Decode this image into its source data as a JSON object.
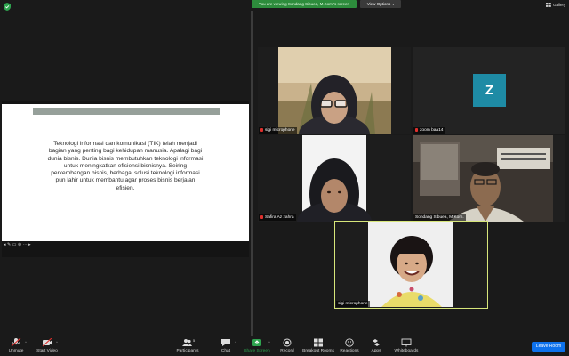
{
  "top_bar": {
    "banner": "You are viewing Sondang Sibuea, M.Kom.'s screen",
    "view_options": "View Options",
    "gallery_view": "Gallery"
  },
  "shared_screen": {
    "slide_text": "Teknologi informasi dan komunikasi (TIK) telah menjadi bagian yang penting bagi kehidupan manusia. Apalagi bagi dunia bisnis. Dunia bisnis membutuhkan teknologi informasi untuk meningkatkan efisiensi bisnisnya. Seiring perkembangan bisnis, berbagai solusi teknologi informasi pun lahir untuk membantu agar proses bisnis berjalan efisien."
  },
  "participants": [
    {
      "name": "sigi microphone",
      "muted": true
    },
    {
      "name": "zoom baa14",
      "muted": true,
      "avatar_letter": "Z"
    },
    {
      "name": "Safira Az zahra",
      "muted": true
    },
    {
      "name": "Sondang Sibuea, M.Kom.",
      "muted": false
    },
    {
      "name": "sigi microphone",
      "muted": false,
      "active_speaker": true
    }
  ],
  "toolbar": {
    "unmute": "Unmute",
    "start_video": "Start Video",
    "participants": "Participants",
    "participants_count": "5",
    "chat": "Chat",
    "share_screen": "Share Screen",
    "record": "Record",
    "breakout_rooms": "Breakout Rooms",
    "reactions": "Reactions",
    "apps": "Apps",
    "whiteboards": "Whiteboards",
    "leave_room": "Leave Room"
  },
  "colors": {
    "share_green": "#2d8c3c",
    "active_speaker_border": "#d7e67a",
    "leave_blue": "#0e71eb",
    "muted_red": "#e0302d",
    "avatar_teal": "#1e8ba5"
  }
}
